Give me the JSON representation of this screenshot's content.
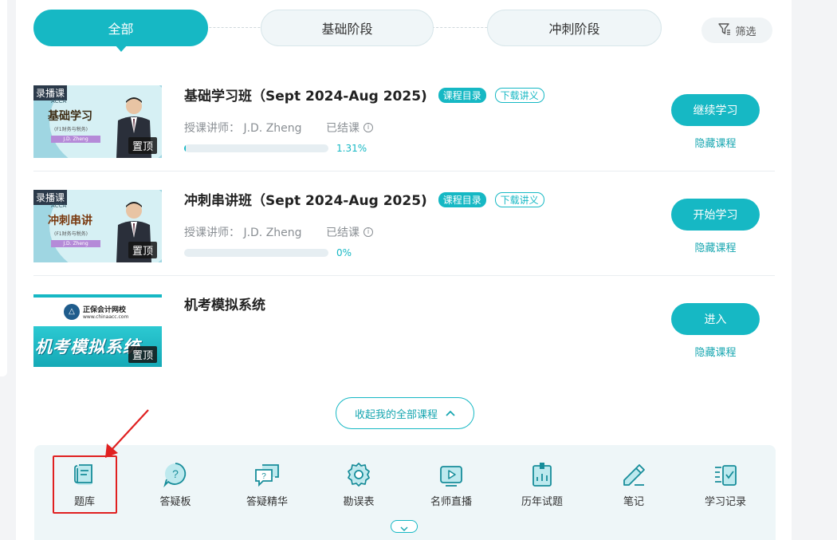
{
  "tabs": [
    {
      "label": "全部",
      "active": true
    },
    {
      "label": "基础阶段",
      "active": false
    },
    {
      "label": "冲刺阶段",
      "active": false
    }
  ],
  "filter": {
    "label": "筛选",
    "icon": "filter-icon"
  },
  "courses": [
    {
      "thumb": {
        "tag": "录播课",
        "small": "ACCA",
        "big": "基础学习",
        "sub": "(F1财务与税务)",
        "author": "J.D. Zheng",
        "pin": "置顶"
      },
      "title": "基础学习班（Sept 2024-Aug 2025)",
      "badge_catalog": "课程目录",
      "badge_download": "下载讲义",
      "teacher": "授课讲师：  J.D. Zheng",
      "status": "已结课",
      "progress": 1.31,
      "progress_label": "1.31%",
      "action": "继续学习",
      "hide": "隐藏课程"
    },
    {
      "thumb": {
        "tag": "录播课",
        "small": "ACCA",
        "big": "冲刺串讲",
        "sub": "(F1财务与税务)",
        "author": "J.D. Zheng",
        "pin": "置顶"
      },
      "title": "冲刺串讲班（Sept 2024-Aug 2025)",
      "badge_catalog": "课程目录",
      "badge_download": "下载讲义",
      "teacher": "授课讲师：  J.D. Zheng",
      "status": "已结课",
      "progress": 0,
      "progress_label": "0%",
      "action": "开始学习",
      "hide": "隐藏课程"
    },
    {
      "thumb": {
        "brand": "正保会计网校",
        "url": "www.chinaacc.com",
        "big": "机考模拟系统",
        "pin": "置顶"
      },
      "title": "机考模拟系统",
      "action": "进入",
      "hide": "隐藏课程"
    }
  ],
  "collapse": {
    "label": "收起我的全部课程"
  },
  "tools": [
    {
      "label": "题库",
      "icon": "question-bank-icon"
    },
    {
      "label": "答疑板",
      "icon": "qa-board-icon"
    },
    {
      "label": "答疑精华",
      "icon": "qa-essence-icon"
    },
    {
      "label": "勘误表",
      "icon": "errata-icon"
    },
    {
      "label": "名师直播",
      "icon": "live-icon"
    },
    {
      "label": "历年试题",
      "icon": "past-exams-icon"
    },
    {
      "label": "笔记",
      "icon": "notes-icon"
    },
    {
      "label": "学习记录",
      "icon": "study-record-icon"
    }
  ],
  "colors": {
    "accent": "#16b8c4",
    "annotation": "#e02020"
  }
}
